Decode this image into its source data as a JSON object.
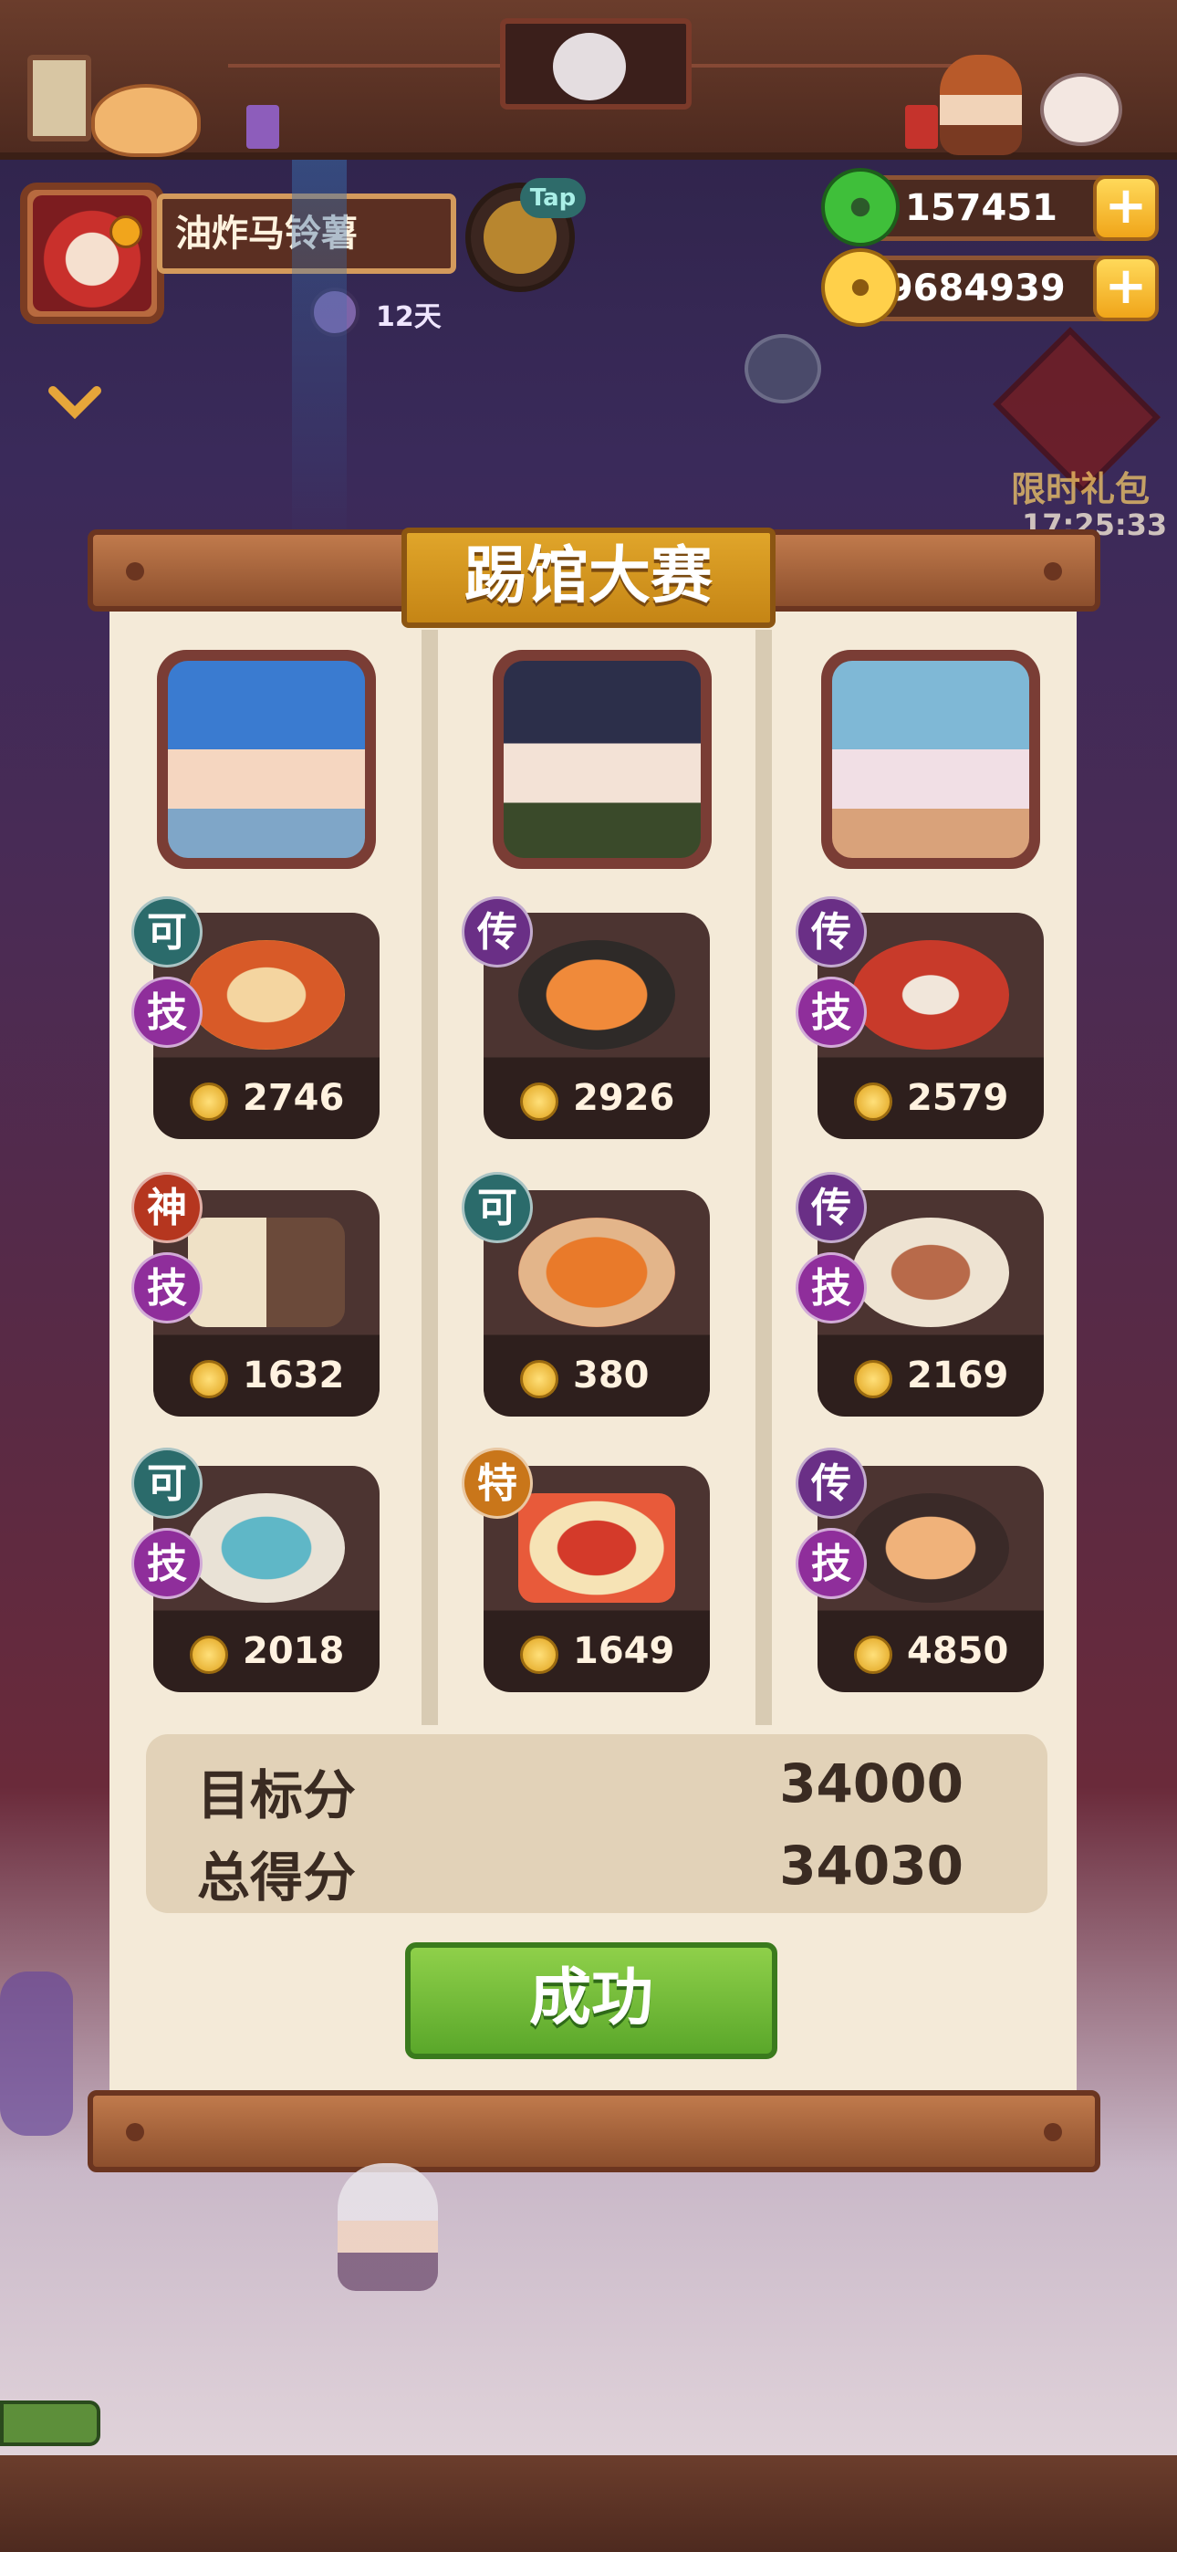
{
  "player": {
    "name": "油炸马铃薯",
    "days": "12天",
    "tap_label": "Tap"
  },
  "currency": {
    "jade": "157451",
    "gold": "59684939"
  },
  "promo": {
    "label": "限时礼包",
    "timer": "17:25:33"
  },
  "contest": {
    "title": "踢馆大赛",
    "columns": [
      {
        "dishes": [
          {
            "grade": "可",
            "skill": "技",
            "score": "2746"
          },
          {
            "grade": "神",
            "skill": "技",
            "score": "1632"
          },
          {
            "grade": "可",
            "skill": "技",
            "score": "2018"
          }
        ]
      },
      {
        "dishes": [
          {
            "grade": "传",
            "skill": "",
            "score": "2926"
          },
          {
            "grade": "可",
            "skill": "",
            "score": "380"
          },
          {
            "grade": "特",
            "skill": "",
            "score": "1649"
          }
        ]
      },
      {
        "dishes": [
          {
            "grade": "传",
            "skill": "技",
            "score": "2579"
          },
          {
            "grade": "传",
            "skill": "技",
            "score": "2169"
          },
          {
            "grade": "传",
            "skill": "技",
            "score": "4850"
          }
        ]
      }
    ],
    "target_label": "目标分",
    "target_value": "34000",
    "total_label": "总得分",
    "total_value": "34030",
    "result_button": "成功"
  },
  "colors": {
    "badge_ke": "#2b6b6b",
    "badge_chuan": "#6a2f86",
    "badge_shen": "#b5361f",
    "badge_te": "#c9761a",
    "badge_ji": "#8f2e9b",
    "success": "#6bb936"
  }
}
